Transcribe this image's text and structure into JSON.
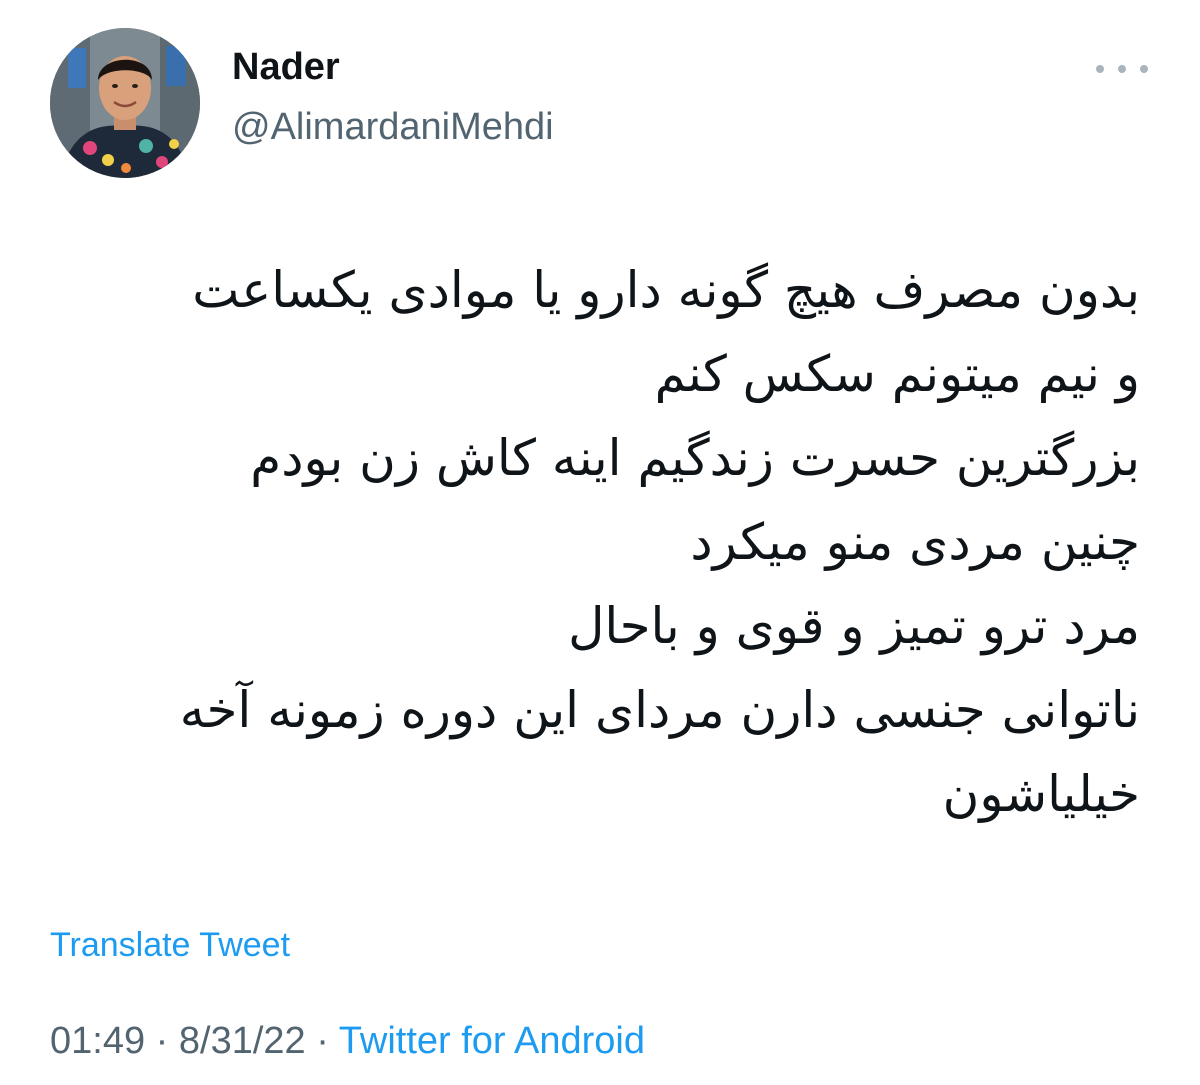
{
  "author": {
    "display_name": "Nader",
    "handle": "@AlimardaniMehdi"
  },
  "more_icon": "more-horizontal-icon",
  "tweet": {
    "lines": [
      "بدون مصرف هیچ گونه دارو یا موادی یکساعت",
      "و نیم میتونم سکس کنم",
      "بزرگترین حسرت زندگیم اینه کاش زن بودم",
      "چنین مردی منو میکرد",
      "مرد ترو تمیز و قوی و باحال",
      "ناتوانی جنسی دارن مردای این دوره زمونه آخه",
      "خیلیاشون"
    ]
  },
  "translate_label": "Translate Tweet",
  "meta": {
    "time": "01:49",
    "separator": "·",
    "date": "8/31/22",
    "source": "Twitter for Android"
  },
  "colors": {
    "link": "#1d9bf0",
    "secondary": "#536471",
    "primary": "#0f1419"
  }
}
